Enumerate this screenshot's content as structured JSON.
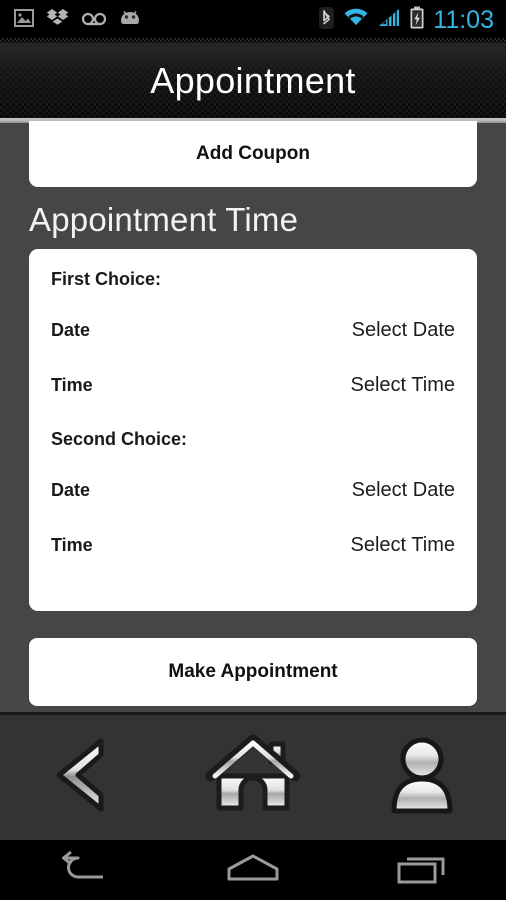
{
  "statusbar": {
    "left_icons": [
      {
        "name": "gallery-image-icon"
      },
      {
        "name": "dropbox-icon"
      },
      {
        "name": "voicemail-icon"
      },
      {
        "name": "android-robot-icon"
      }
    ],
    "right_icons": [
      {
        "name": "bluetooth-icon"
      },
      {
        "name": "wifi-icon"
      },
      {
        "name": "cell-signal-icon"
      },
      {
        "name": "battery-charging-icon"
      }
    ],
    "clock": "11:03",
    "clock_color": "#33b5e5"
  },
  "header": {
    "title": "Appointment"
  },
  "coupon": {
    "label": "Add Coupon"
  },
  "appointment_time": {
    "heading": "Appointment Time",
    "groups": [
      {
        "heading": "First Choice:",
        "rows": [
          {
            "label": "Date",
            "value": "Select Date"
          },
          {
            "label": "Time",
            "value": "Select Time"
          }
        ]
      },
      {
        "heading": "Second Choice:",
        "rows": [
          {
            "label": "Date",
            "value": "Select Date"
          },
          {
            "label": "Time",
            "value": "Select Time"
          }
        ]
      }
    ]
  },
  "submit": {
    "label": "Make Appointment"
  },
  "app_nav": {
    "items": [
      {
        "name": "back-chevron-icon"
      },
      {
        "name": "home-icon"
      },
      {
        "name": "profile-person-icon"
      }
    ]
  },
  "system_nav": {
    "items": [
      {
        "name": "android-back-icon"
      },
      {
        "name": "android-home-icon"
      },
      {
        "name": "android-recents-icon"
      }
    ]
  },
  "colors": {
    "page_background": "#464646",
    "card_background": "#ffffff",
    "header_background": "#0d0d0d",
    "accent_blue": "#33b5e5",
    "app_nav_background": "#333333"
  }
}
